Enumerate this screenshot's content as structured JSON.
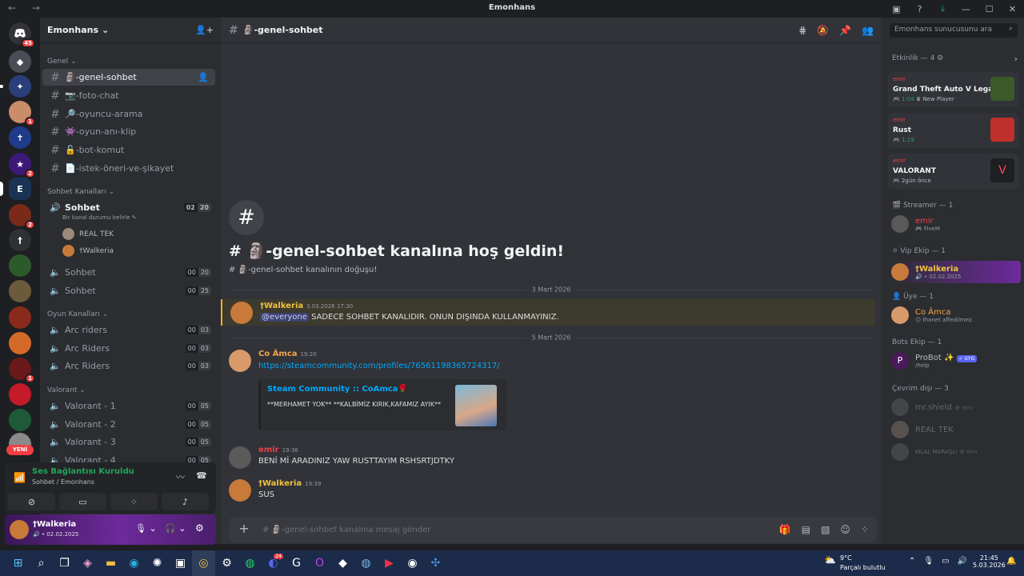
{
  "window": {
    "title": "Emonhans"
  },
  "server_badges": {
    "home": "45",
    "s5": "1",
    "s8": "2",
    "s12": "2",
    "s20": "1",
    "new": "YENİ"
  },
  "guild": {
    "name": "Emonhans"
  },
  "categories": {
    "general": "Genel",
    "voice": "Sohbet Kanalları",
    "game": "Oyun Kanalları",
    "valorant": "Valorant"
  },
  "text_channels": [
    {
      "name": "-genel-sohbet",
      "emoji": "🗿"
    },
    {
      "name": "-foto-chat",
      "emoji": "📷"
    },
    {
      "name": "-oyuncu-arama",
      "emoji": "🔎"
    },
    {
      "name": "-oyun-anı-klip",
      "emoji": "👾"
    },
    {
      "name": "-bot-komut",
      "emoji": "🔓"
    },
    {
      "name": "-istek-öneri-ve-şikayet",
      "emoji": "📄"
    }
  ],
  "voice_active": {
    "name": "Sohbet",
    "status": "Bir kanal durumu belirle",
    "count": [
      "02",
      "20"
    ],
    "users": [
      "REAL TEK",
      "†Walkeria"
    ]
  },
  "voice_channels": [
    {
      "name": "Sohbet",
      "count": [
        "00",
        "20"
      ]
    },
    {
      "name": "Sohbet",
      "count": [
        "00",
        "25"
      ]
    },
    {
      "name": "Arc riders",
      "count": [
        "00",
        "03"
      ]
    },
    {
      "name": "Arc Riders",
      "count": [
        "00",
        "03"
      ]
    },
    {
      "name": "Arc Riders",
      "count": [
        "00",
        "03"
      ]
    },
    {
      "name": "Valorant - 1",
      "count": [
        "00",
        "05"
      ]
    },
    {
      "name": "Valorant - 2",
      "count": [
        "00",
        "05"
      ]
    },
    {
      "name": "Valorant - 3",
      "count": [
        "00",
        "05"
      ]
    },
    {
      "name": "Valorant - 4",
      "count": [
        "00",
        "05"
      ]
    }
  ],
  "voice_panel": {
    "status": "Ses Bağlantısı Kuruldu",
    "location": "Sohbet / Emonhans"
  },
  "user_panel": {
    "name": "†Walkeria",
    "status": "• 02.02.2025"
  },
  "channel_header": {
    "name": "-genel-sohbet",
    "emoji": "🗿"
  },
  "welcome": {
    "title": "-genel-sohbet kanalına hoş geldin!",
    "subtitle": "-genel-sohbet kanalının doğuşu!",
    "hash": "#"
  },
  "dates": {
    "d1": "3 Mart 2026",
    "d2": "5 Mart 2026"
  },
  "messages": [
    {
      "author": "†Walkeria",
      "time": "3.03.2026 17:30",
      "mention": "@everyone",
      "text": "SADECE SOHBET KANALIDIR. ONUN DIŞINDA KULLANMAYINIZ."
    },
    {
      "author": "Co Âmca",
      "time": "19:20",
      "text": "https://steamcommunity.com/profiles/76561198365724317/",
      "embed_title": "Steam Community :: CoAmca🌹",
      "embed_desc": "**MERHAMET YOK** **KALBİMİZ KIRIK,KAFAMIZ AYIK**"
    },
    {
      "author": "emir",
      "time": "19:36",
      "text": "BENİ Mİ ARADINIZ YAW RUSTTAYIM RSHSRTJDTKY"
    },
    {
      "author": "†Walkeria",
      "time": "19:39",
      "text": "SUS"
    }
  ],
  "input": {
    "placeholder": "-genel-sohbet kanalına mesaj gönder"
  },
  "members": {
    "search_placeholder": "Emonhans sunucusunu ara",
    "activity_header": "Etkinlik — 4",
    "activities": [
      {
        "user": "emir",
        "game": "Grand Theft Auto V Legacy",
        "time": "1:04",
        "extra": "New Player"
      },
      {
        "user": "emir",
        "game": "Rust",
        "time": "1:19",
        "extra": ""
      },
      {
        "user": "emir",
        "game": "VALORANT",
        "time": "2gün önce",
        "extra": ""
      }
    ],
    "streamer_header": "Streamer — 1",
    "streamer": {
      "name": "emir",
      "status": "FiveM"
    },
    "vip_header": "Vip Ekip — 1",
    "vip": {
      "name": "†Walkeria",
      "status": "• 02.02.2025"
    },
    "uye_header": "Üye — 1",
    "uye": {
      "name": "Co Âmca",
      "status": "İhanet affedilmez."
    },
    "bots_header": "Bots Ekip — 1",
    "bot": {
      "name": "ProBot ✨",
      "tag": "✓ UYG",
      "status": "/help"
    },
    "offline_header": "Çevrim dışı — 3",
    "offline": [
      {
        "name": "mr.shield",
        "tag": "MYH"
      },
      {
        "name": "REAL TEK",
        "tag": ""
      },
      {
        "name": "KILAL MARAŞLI",
        "tag": "MYH"
      }
    ]
  },
  "taskbar": {
    "temp": "9°C",
    "weather": "Parçalı bulutlu",
    "time": "21:45",
    "date": "5.03.2026",
    "discord_badge": "24"
  },
  "colors": {
    "walkeria": "#f0c040",
    "coamca": "#f2a54a",
    "emir": "#ed4245",
    "link": "#00a8fc",
    "green": "#23a55a"
  }
}
